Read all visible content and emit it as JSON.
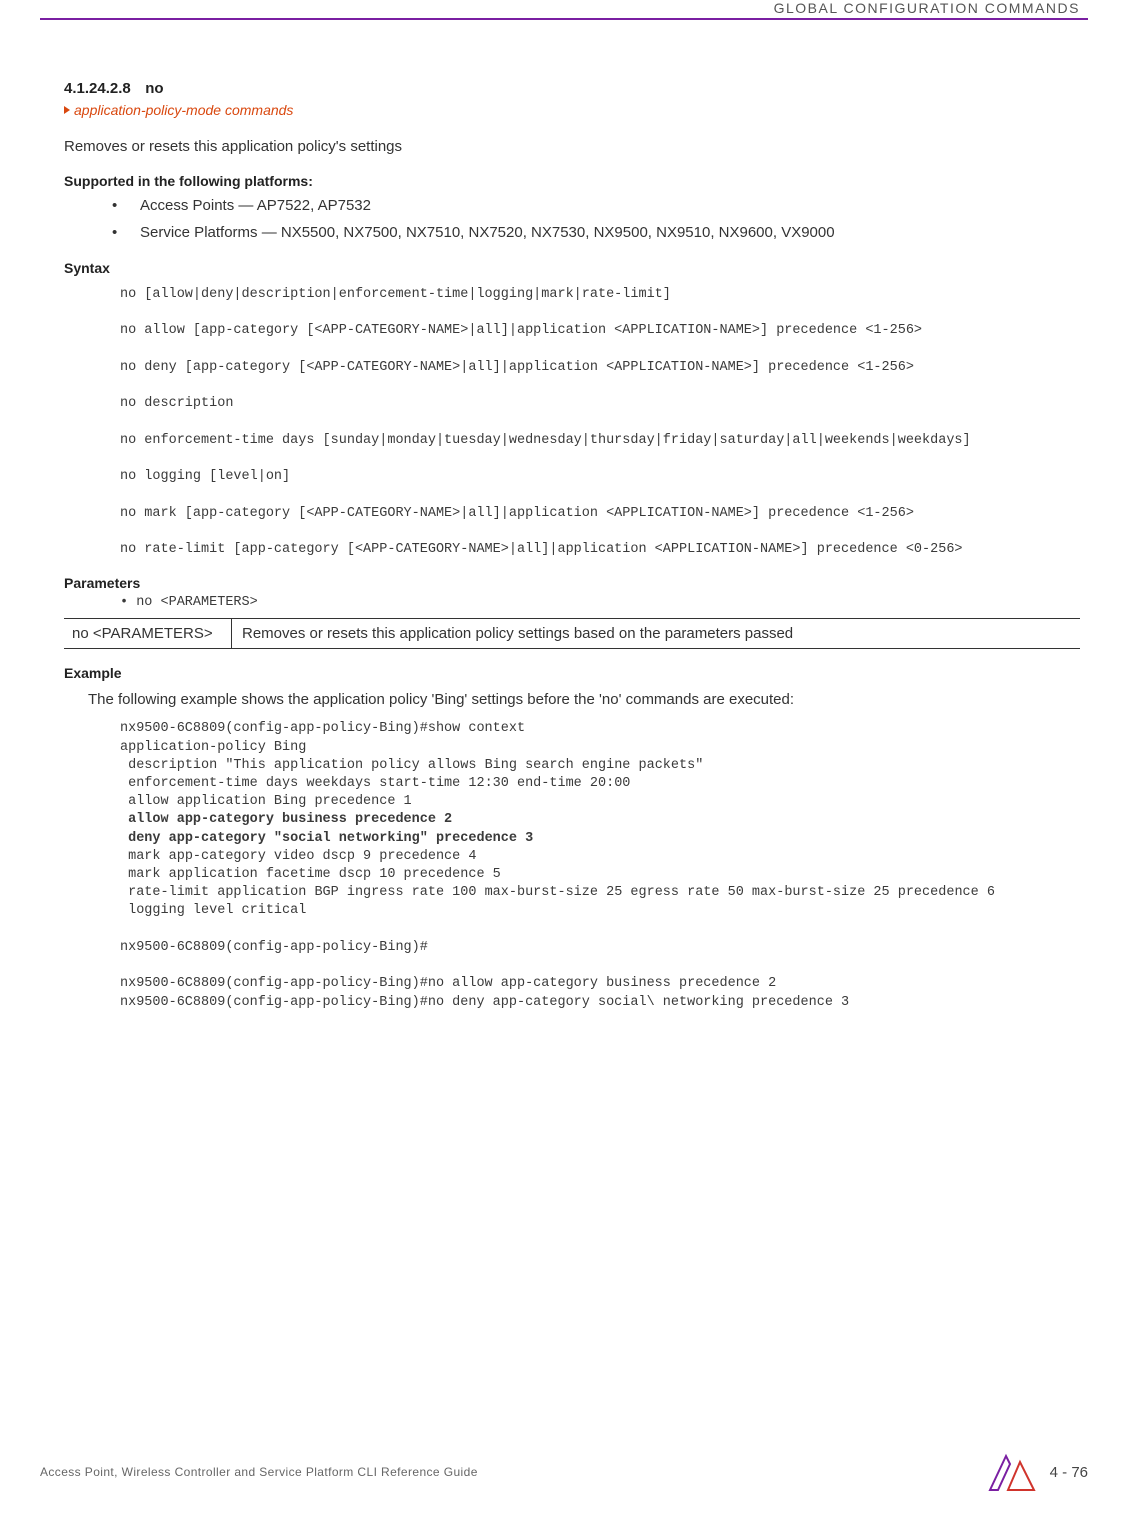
{
  "header": {
    "running_title": "GLOBAL CONFIGURATION COMMANDS"
  },
  "section": {
    "number": "4.1.24.2.8",
    "title": "no",
    "breadcrumb": "application-policy-mode commands",
    "intro": "Removes or resets this application policy's settings"
  },
  "supported": {
    "heading": "Supported in the following platforms:",
    "items": [
      "Access Points — AP7522, AP7532",
      "Service Platforms — NX5500, NX7500, NX7510, NX7520, NX7530, NX9500, NX9510, NX9600, VX9000"
    ]
  },
  "syntax": {
    "heading": "Syntax",
    "lines": [
      "no [allow|deny|description|enforcement-time|logging|mark|rate-limit]",
      "",
      "no allow [app-category [<APP-CATEGORY-NAME>|all]|application <APPLICATION-NAME>] precedence <1-256>",
      "",
      "no deny [app-category [<APP-CATEGORY-NAME>|all]|application <APPLICATION-NAME>] precedence <1-256>",
      "",
      "no description",
      "",
      "no enforcement-time days [sunday|monday|tuesday|wednesday|thursday|friday|saturday|all|weekends|weekdays]",
      "",
      "no logging [level|on]",
      "",
      "no mark [app-category [<APP-CATEGORY-NAME>|all]|application <APPLICATION-NAME>] precedence <1-256>",
      "",
      "no rate-limit [app-category [<APP-CATEGORY-NAME>|all]|application <APPLICATION-NAME>] precedence <0-256>"
    ]
  },
  "parameters": {
    "heading": "Parameters",
    "bullet": "• no <PARAMETERS>",
    "table": {
      "c1": "no <PARAMETERS>",
      "c2": "Removes or resets this application policy settings based on the parameters passed"
    }
  },
  "example": {
    "heading": "Example",
    "intro": "The following example shows the application policy 'Bing' settings before the 'no' commands are executed:",
    "block_pre": "nx9500-6C8809(config-app-policy-Bing)#show context\napplication-policy Bing\n description \"This application policy allows Bing search engine packets\"\n enforcement-time days weekdays start-time 12:30 end-time 20:00\n allow application Bing precedence 1",
    "block_bold1": " allow app-category business precedence 2",
    "block_bold2": " deny app-category \"social networking\" precedence 3",
    "block_post": " mark app-category video dscp 9 precedence 4\n mark application facetime dscp 10 precedence 5\n rate-limit application BGP ingress rate 100 max-burst-size 25 egress rate 50 max-burst-size 25 precedence 6\n logging level critical\n\nnx9500-6C8809(config-app-policy-Bing)#\n\nnx9500-6C8809(config-app-policy-Bing)#no allow app-category business precedence 2\nnx9500-6C8809(config-app-policy-Bing)#no deny app-category social\\ networking precedence 3"
  },
  "footer": {
    "left": "Access Point, Wireless Controller and Service Platform CLI Reference Guide",
    "page": "4 - 76"
  }
}
